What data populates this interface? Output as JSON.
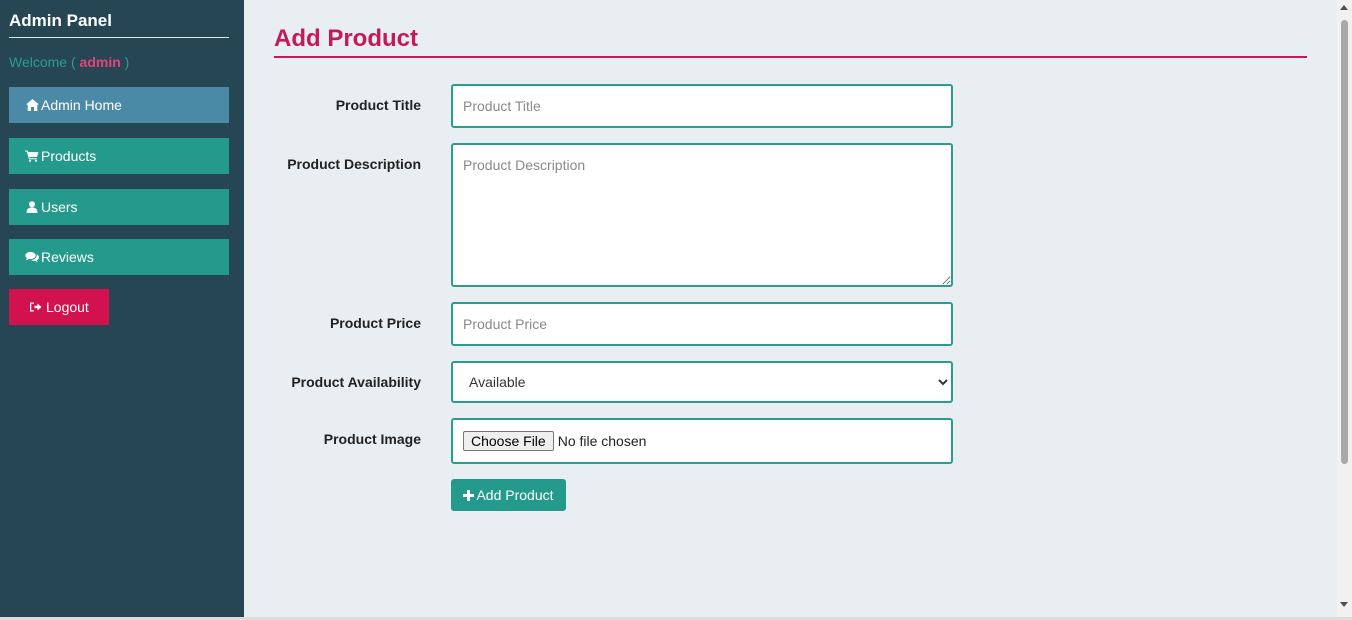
{
  "sidebar": {
    "brand": "Admin Panel",
    "welcome_prefix": "Welcome (",
    "welcome_user": "admin",
    "welcome_suffix": ")",
    "items": [
      {
        "label": "Admin Home",
        "icon": "home-icon"
      },
      {
        "label": "Products",
        "icon": "cart-icon"
      },
      {
        "label": "Users",
        "icon": "user-icon"
      },
      {
        "label": "Reviews",
        "icon": "comments-icon"
      }
    ],
    "logout_label": "Logout",
    "logout_icon": "sign-out-icon"
  },
  "main": {
    "title": "Add Product",
    "form": {
      "title_label": "Product Title",
      "title_placeholder": "Product Title",
      "description_label": "Product Description",
      "description_placeholder": "Product Description",
      "price_label": "Product Price",
      "price_placeholder": "Product Price",
      "availability_label": "Product Availability",
      "availability_selected": "Available",
      "image_label": "Product Image",
      "choose_file_label": "Choose File",
      "no_file_text": "No file chosen",
      "submit_label": "Add Product",
      "submit_icon": "plus-icon"
    }
  },
  "colors": {
    "sidebar_bg": "#264653",
    "accent_teal": "#239a8b",
    "active_nav": "#4a8aa6",
    "danger": "#d1124f",
    "title_pink": "#c41a57",
    "page_bg": "#e9eef2"
  }
}
